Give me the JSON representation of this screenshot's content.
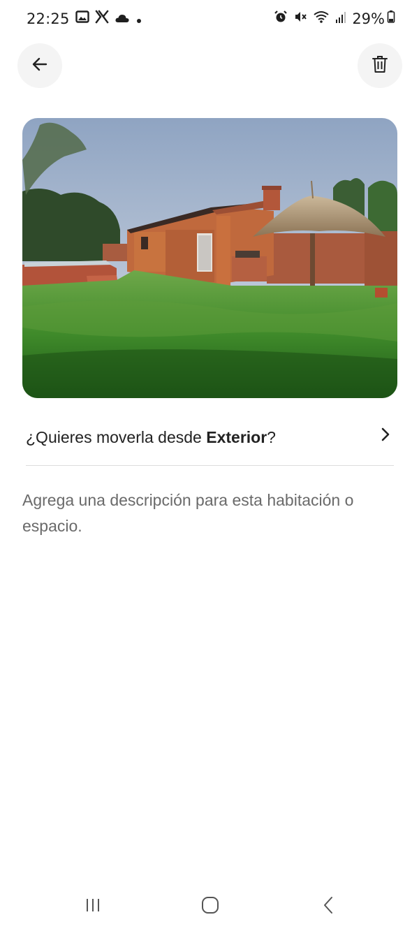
{
  "status_bar": {
    "time": "22:25",
    "left_icons": [
      "gallery-icon",
      "x-icon",
      "cloud-icon",
      "dot-icon"
    ],
    "right_icons": [
      "alarm-icon",
      "mute-icon",
      "wifi-icon",
      "signal-icon",
      "battery-icon"
    ],
    "battery": "29%"
  },
  "header": {
    "back_icon": "arrow-left-icon",
    "delete_icon": "trash-icon"
  },
  "photo": {
    "subject": "house-exterior-photo"
  },
  "move_row": {
    "prefix": "¿Quieres moverla desde ",
    "room": "Exterior",
    "suffix": "?",
    "chevron_icon": "chevron-right-icon"
  },
  "description": {
    "placeholder": "Agrega una descripción para esta habitación o espacio."
  },
  "nav_bar": {
    "recent_icon": "recent-apps-icon",
    "home_icon": "home-icon",
    "back_icon": "back-icon"
  },
  "colors": {
    "text_primary": "#222222",
    "text_secondary": "#6a6a6a",
    "button_bg": "#f4f4f4",
    "divider": "#dddddd"
  }
}
